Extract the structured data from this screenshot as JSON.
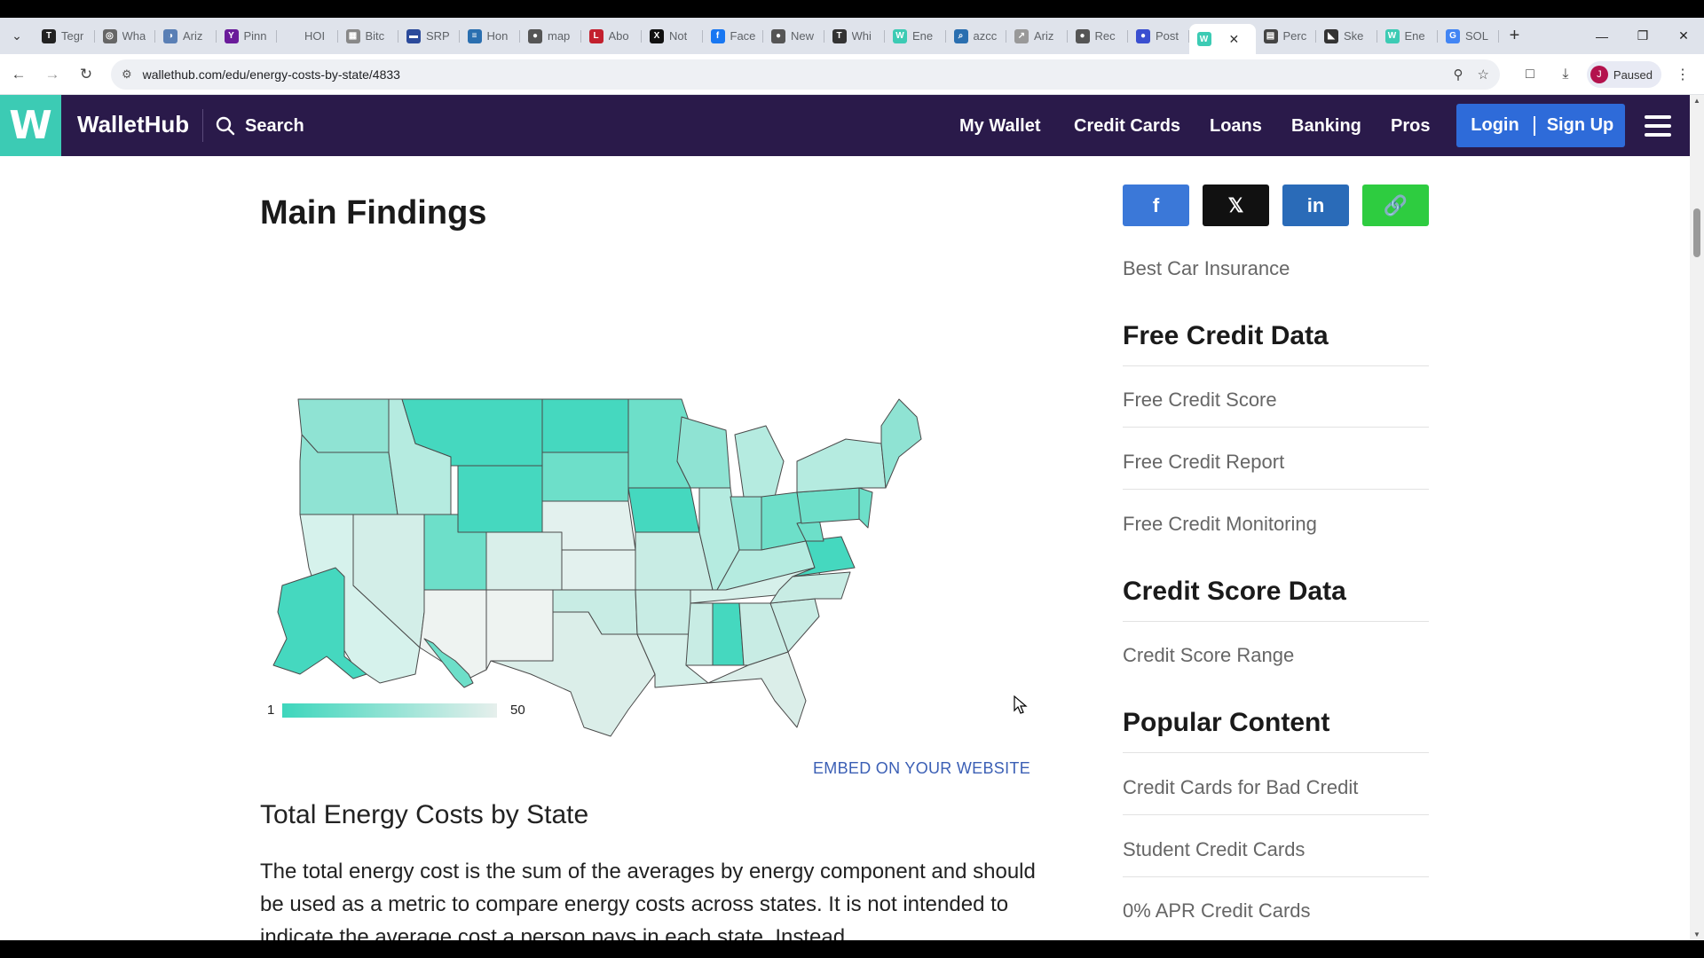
{
  "browser": {
    "tabs": [
      {
        "label": "Tegr",
        "fav": "T",
        "color": "#222"
      },
      {
        "label": "Wha",
        "fav": "◎",
        "color": "#666"
      },
      {
        "label": "Ariz",
        "fav": "◑",
        "color": "#5a7fb5"
      },
      {
        "label": "Pinn",
        "fav": "Y",
        "color": "#6a1b9a"
      },
      {
        "label": "HOI",
        "fav": "",
        "color": "#dfe3eb"
      },
      {
        "label": "Bitc",
        "fav": "▦",
        "color": "#888"
      },
      {
        "label": "SRP",
        "fav": "▬",
        "color": "#2b4a9b"
      },
      {
        "label": "Hon",
        "fav": "≡",
        "color": "#2a6fb0"
      },
      {
        "label": "map",
        "fav": "●",
        "color": "#555"
      },
      {
        "label": "Abo",
        "fav": "L",
        "color": "#c3202e"
      },
      {
        "label": "Not",
        "fav": "X",
        "color": "#111"
      },
      {
        "label": "Face",
        "fav": "f",
        "color": "#1877f2"
      },
      {
        "label": "New",
        "fav": "●",
        "color": "#555"
      },
      {
        "label": "Whi",
        "fav": "T",
        "color": "#333"
      },
      {
        "label": "Ene",
        "fav": "W",
        "color": "#3ccbb4"
      },
      {
        "label": "azcc",
        "fav": "⌕",
        "color": "#2a6fb0"
      },
      {
        "label": "Ariz",
        "fav": "↗",
        "color": "#999"
      },
      {
        "label": "Rec",
        "fav": "●",
        "color": "#555"
      },
      {
        "label": "Post",
        "fav": "●",
        "color": "#3a4fd0"
      },
      {
        "label": "",
        "fav": "W",
        "color": "#3ccbb4",
        "active": true
      },
      {
        "label": "Perc",
        "fav": "▤",
        "color": "#444"
      },
      {
        "label": "Ske",
        "fav": "◣",
        "color": "#333"
      },
      {
        "label": "Ene",
        "fav": "W",
        "color": "#3ccbb4"
      },
      {
        "label": "SOL",
        "fav": "G",
        "color": "#4285f4"
      }
    ],
    "url": "wallethub.com/edu/energy-costs-by-state/4833",
    "profile_label": "Paused",
    "profile_initial": "J"
  },
  "header": {
    "logo_letter": "W",
    "brand": "WalletHub",
    "search_label": "Search",
    "nav": [
      "My Wallet",
      "Credit Cards",
      "Loans",
      "Banking",
      "Pros"
    ],
    "login_label": "Login",
    "signup_label": "Sign Up"
  },
  "main": {
    "heading": "Main Findings",
    "legend_low": "1",
    "legend_high": "50",
    "embed_label": "EMBED ON YOUR WEBSITE",
    "subheading": "Total Energy Costs by State",
    "paragraph": "The total energy cost is the sum of the averages by energy component and should be used as a metric to compare energy costs across states. It is not intended to indicate the average cost a person pays in each state. Instead,"
  },
  "sidebar": {
    "first_link": "Best Car Insurance",
    "sections": [
      {
        "title": "Free Credit Data",
        "links": [
          "Free Credit Score",
          "Free Credit Report",
          "Free Credit Monitoring"
        ]
      },
      {
        "title": "Credit Score Data",
        "links": [
          "Credit Score Range"
        ]
      },
      {
        "title": "Popular Content",
        "links": [
          "Credit Cards for Bad Credit",
          "Student Credit Cards",
          "0% APR Credit Cards"
        ]
      }
    ]
  },
  "colors": {
    "header_bg": "#2a1a4a",
    "brand_teal": "#3ccbb4",
    "auth_blue": "#2e6bd9",
    "facebook": "#3b78d8",
    "x": "#111111",
    "linkedin": "#2a6bb8",
    "copy_link": "#2ecc40"
  }
}
